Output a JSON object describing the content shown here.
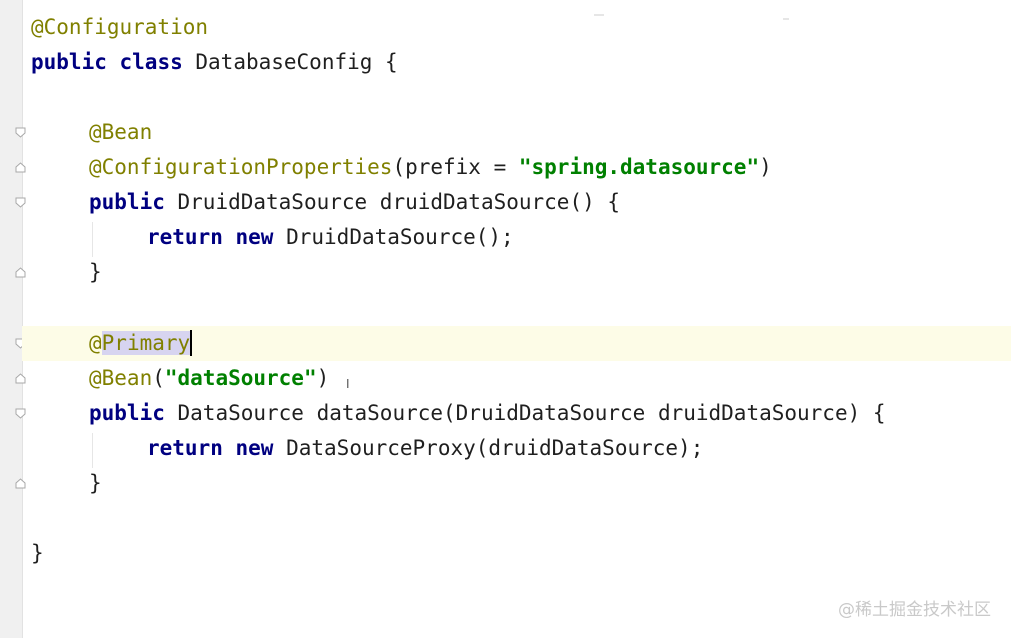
{
  "editor": {
    "lines": [
      {
        "a": "@Configuration"
      },
      {
        "k1": "public",
        "k2": "class",
        "t": "DatabaseConfig {"
      },
      {
        "a": "@Bean"
      },
      {
        "a": "@ConfigurationProperties",
        "p1": "(prefix = ",
        "s": "\"spring.datasource\"",
        "p2": ")"
      },
      {
        "k1": "public",
        "t": "DruidDataSource druidDataSource() {"
      },
      {
        "k1": "return",
        "k2": "new",
        "t": "DruidDataSource();"
      },
      {
        "t": "}"
      },
      {
        "a_pre": "@",
        "a_sel": "Primary"
      },
      {
        "a": "@Bean",
        "p1": "(",
        "s": "\"dataSource\"",
        "p2": ")"
      },
      {
        "k1": "public",
        "t": "DataSource dataSource(DruidDataSource druidDataSource) {"
      },
      {
        "k1": "return",
        "k2": "new",
        "t": "DataSourceProxy(druidDataSource);"
      },
      {
        "t": "}"
      },
      {
        "t": "}"
      }
    ]
  },
  "cursor_glyph": "I",
  "watermark": "@稀土掘金技术社区",
  "colors": {
    "keyword": "#000080",
    "annotation": "#808000",
    "string": "#008000",
    "current_line": "#fdfce7",
    "selection": "#d7d4f0"
  }
}
